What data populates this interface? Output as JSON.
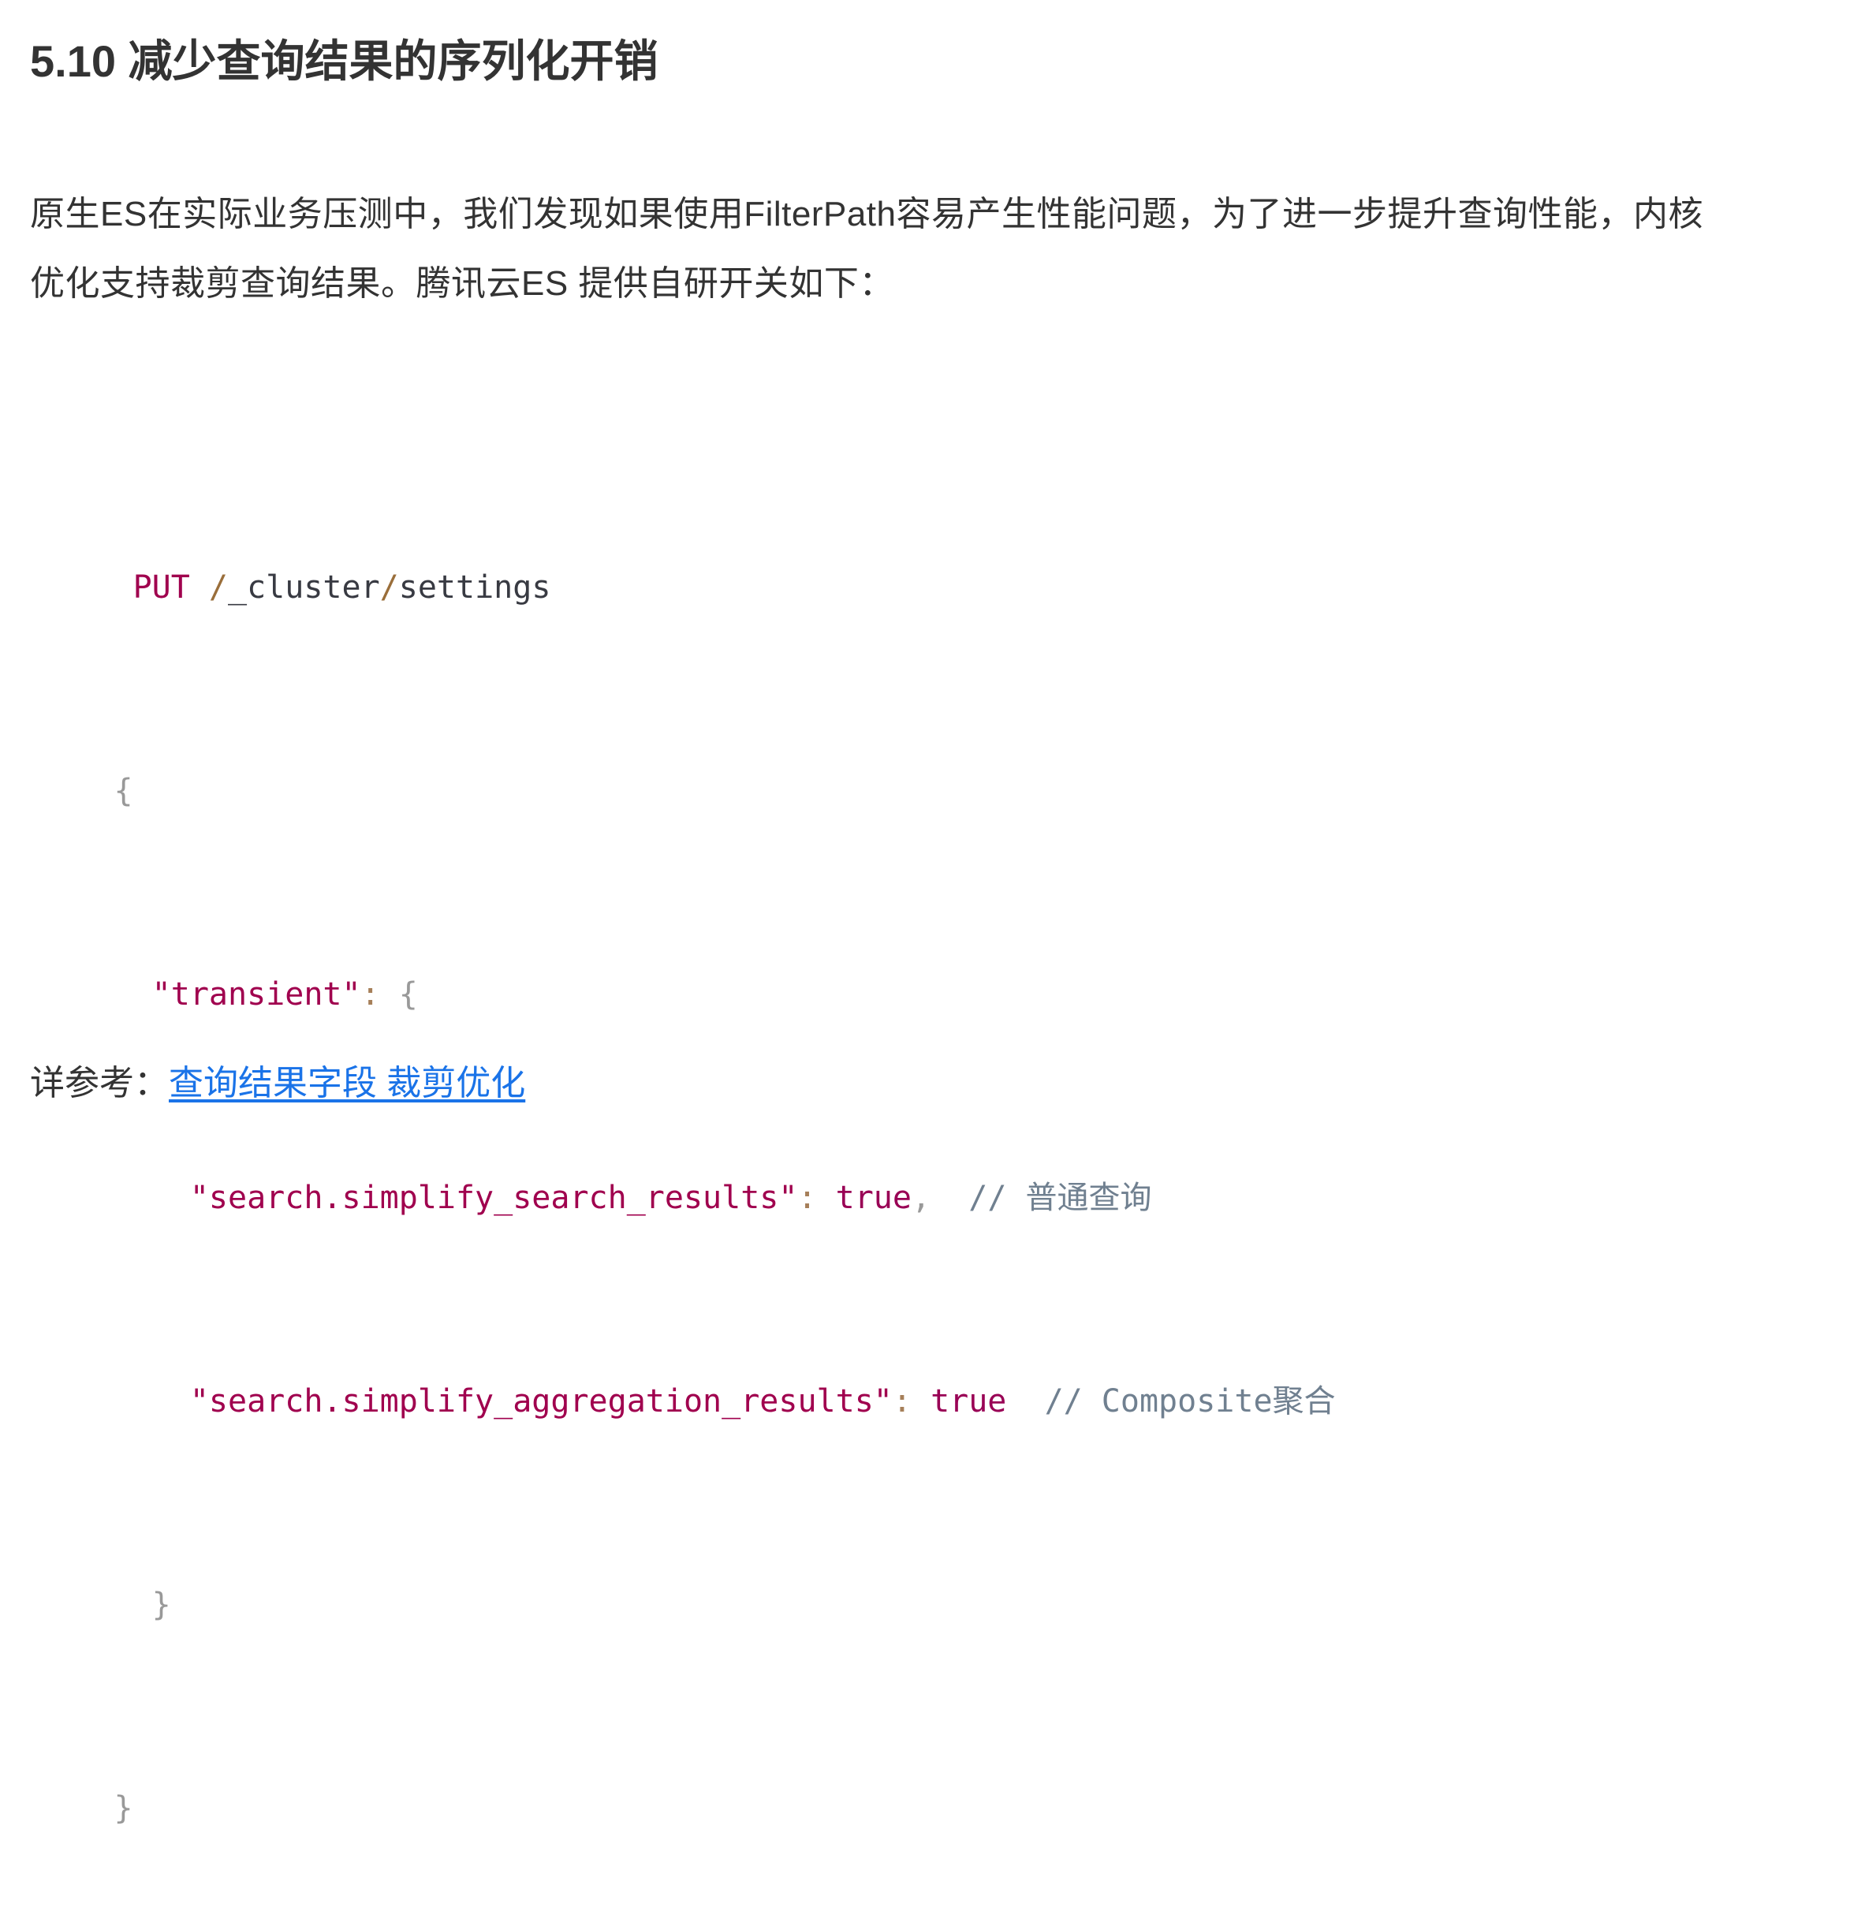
{
  "heading": "5.10 减少查询结果的序列化开销",
  "paragraph": {
    "line1": "原生ES在实际业务压测中，我们发现如果使用FilterPath容易产生性能问题，为了进一步提升查询性能，内核",
    "line2": "优化支持裁剪查询结果。腾讯云ES 提供自研开关如下："
  },
  "code": {
    "method": "PUT",
    "path_sep1": "/",
    "path_seg1": "_cluster",
    "path_sep2": "/",
    "path_seg2": "settings",
    "open_brace": "{",
    "transient_key": "\"transient\"",
    "colon": ":",
    "transient_open": "{",
    "key1": "\"search.simplify_search_results\"",
    "key1_colon": ":",
    "val1": "true",
    "comma": ",",
    "comment1": "// 普通查询",
    "key2": "\"search.simplify_aggregation_results\"",
    "key2_colon": ":",
    "val2": "true",
    "comment2": "// Composite聚合",
    "transient_close": "}",
    "close_brace": "}"
  },
  "reference": {
    "label": "详参考：",
    "link_text": "查询结果字段 裁剪优化"
  }
}
